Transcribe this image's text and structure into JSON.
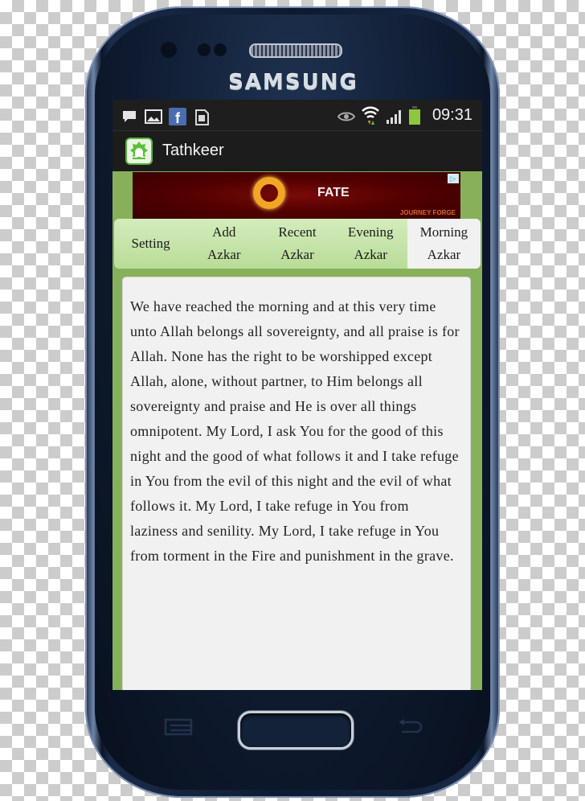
{
  "device": {
    "brand": "SAMSUNG"
  },
  "status_bar": {
    "left_icons": [
      "chat-icon",
      "image-icon",
      "facebook-icon",
      "sim-card-icon"
    ],
    "right_icons": [
      "eye-icon",
      "wifi-icon",
      "signal-icon",
      "battery-icon"
    ],
    "time": "09:31"
  },
  "action_bar": {
    "app_icon": "mosque-icon",
    "title": "Tathkeer"
  },
  "ad_banner": {
    "title": "FATE",
    "subtitle": "JOURNEY FORGE",
    "adchoices_glyph": "▷"
  },
  "tabs": [
    {
      "line1": "Setting",
      "line2": "",
      "active": false
    },
    {
      "line1": "Add",
      "line2": "Azkar",
      "active": false
    },
    {
      "line1": "Recent",
      "line2": "Azkar",
      "active": false
    },
    {
      "line1": "Evening",
      "line2": "Azkar",
      "active": false
    },
    {
      "line1": "Morning",
      "line2": "Azkar",
      "active": true
    }
  ],
  "content": {
    "text": "We have reached the morning and at this very time unto Allah belongs all sovereignty, and all praise is for Allah. None has the right to be worshipped except Allah, alone, without partner, to Him belongs all sovereignty and praise and He is over all things omnipotent. My Lord, I ask You for the good of this night and the good of what follows it and I take refuge in You from the evil of this night and the evil of what follows it. My Lord, I take refuge in You from laziness and senility. My Lord, I take refuge in You from torment in the Fire and punishment in the grave."
  },
  "hardware_keys": {
    "menu_icon": "menu-icon",
    "home_icon": "home-button",
    "back_icon": "back-icon"
  },
  "colors": {
    "app_background": "#86b15a",
    "tab_gradient_top": "#d4ecbc",
    "tab_active": "#f1f1f1",
    "status_bar": "#1e1e1e",
    "battery": "#8dc63f"
  }
}
